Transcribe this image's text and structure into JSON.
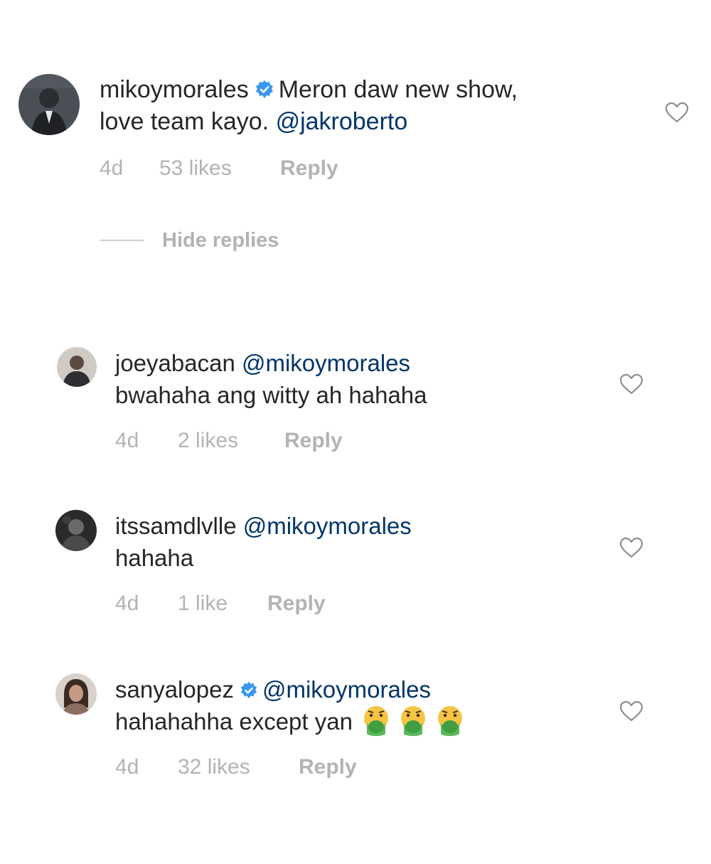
{
  "comments": [
    {
      "username": "mikoymorales",
      "verified": true,
      "text_line1": "Meron daw new show,",
      "text_line2_prefix": "love team kayo. ",
      "mention": "@jakroberto",
      "time": "4d",
      "likes": "53 likes",
      "reply_label": "Reply"
    }
  ],
  "hide_replies_label": "Hide replies",
  "replies": [
    {
      "username": "joeyabacan",
      "mention": "@mikoymorales",
      "text": "bwahaha ang witty ah hahaha",
      "time": "4d",
      "likes": "2 likes",
      "reply_label": "Reply"
    },
    {
      "username": "itssamdlvlle",
      "mention": "@mikoymorales",
      "text": "hahaha",
      "time": "4d",
      "likes": "1 like",
      "reply_label": "Reply"
    },
    {
      "username": "sanyalopez",
      "verified": true,
      "mention": "@mikoymorales",
      "text": "hahahahha except yan",
      "emojis": "nauseated-face x3",
      "time": "4d",
      "likes": "32 likes",
      "reply_label": "Reply"
    }
  ],
  "colors": {
    "text": "#262626",
    "mention": "#003569",
    "meta": "#b3b3b3",
    "verified": "#3897f0"
  }
}
